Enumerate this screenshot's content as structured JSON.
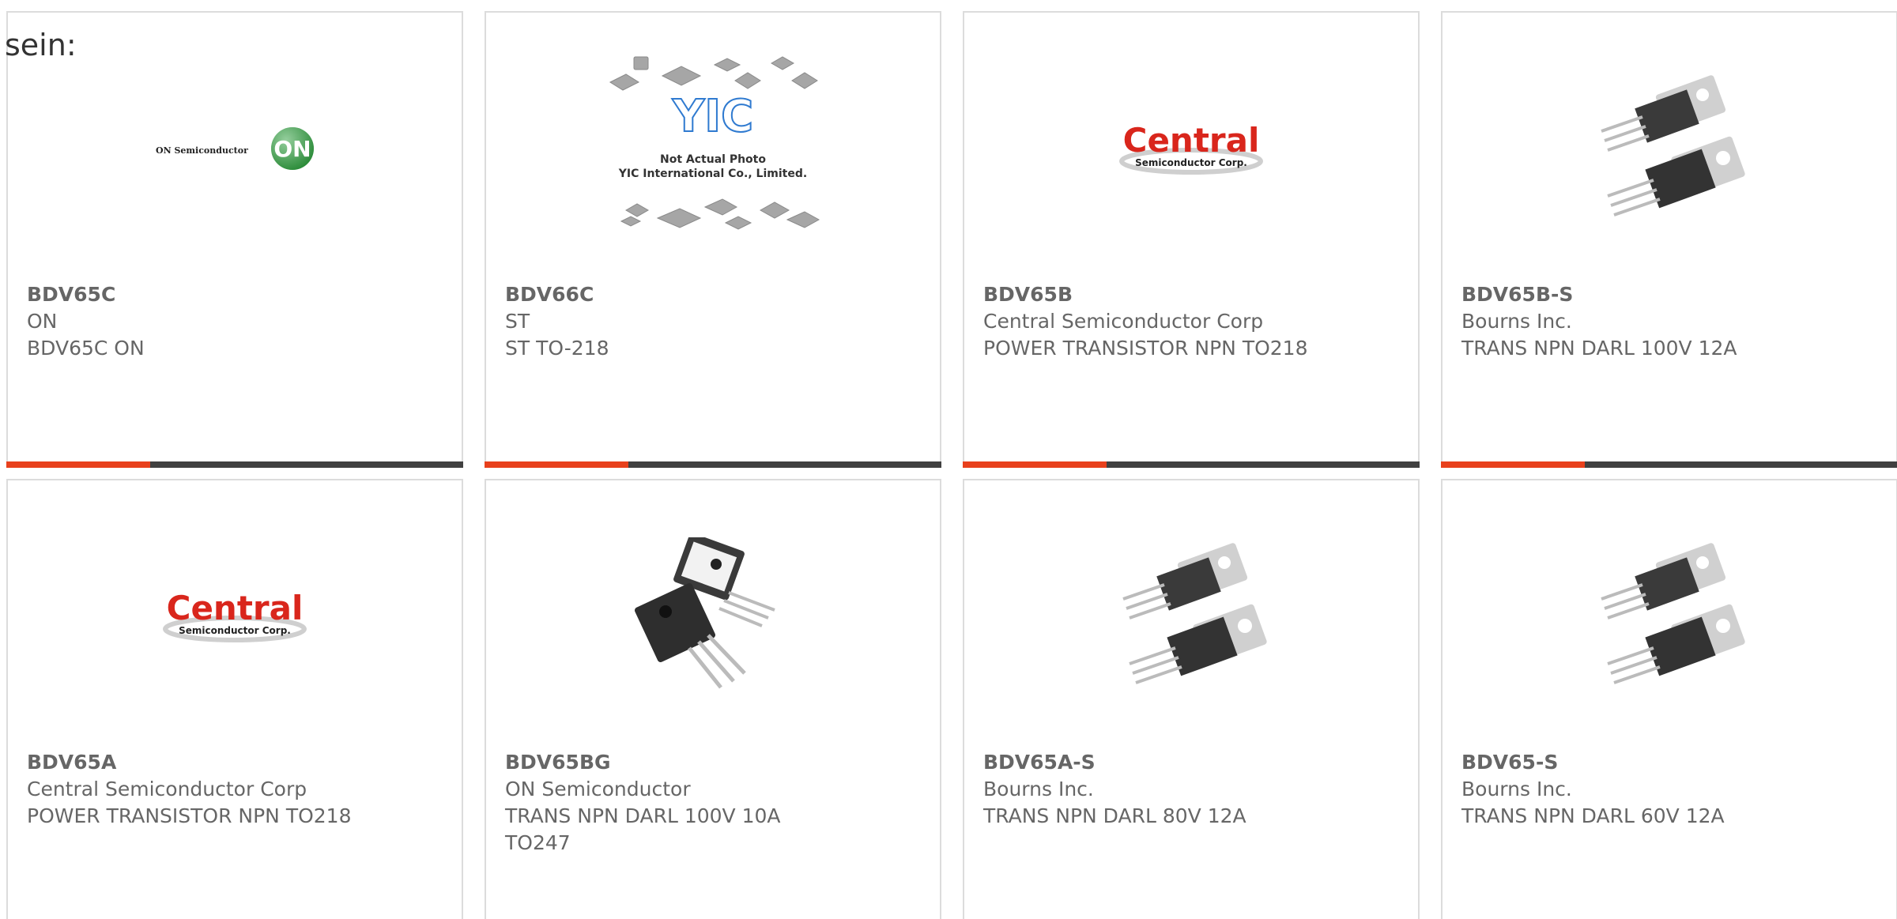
{
  "intro_text": "sein:",
  "products": [
    {
      "part": "BDV65C",
      "manufacturer": "ON",
      "description": "BDV65C ON",
      "image": "on-semiconductor-logo",
      "image_text": [
        "ON Semiconductor",
        "ON"
      ]
    },
    {
      "part": "BDV66C",
      "manufacturer": "ST",
      "description": "ST TO-218",
      "image": "yic-not-actual-photo",
      "image_text": [
        "YIC",
        "Not Actual Photo",
        "YIC International Co., Limited."
      ]
    },
    {
      "part": "BDV65B",
      "manufacturer": "Central Semiconductor Corp",
      "description": "POWER TRANSISTOR NPN TO218",
      "image": "central-semiconductor-logo",
      "image_text": [
        "Central",
        "Semiconductor Corp."
      ]
    },
    {
      "part": "BDV65B-S",
      "manufacturer": "Bourns Inc.",
      "description": "TRANS NPN DARL 100V 12A",
      "image": "to220-transistor-photo"
    },
    {
      "part": "BDV65A",
      "manufacturer": "Central Semiconductor Corp",
      "description": "POWER TRANSISTOR NPN TO218",
      "image": "central-semiconductor-logo",
      "image_text": [
        "Central",
        "Semiconductor Corp."
      ]
    },
    {
      "part": "BDV65BG",
      "manufacturer": "ON Semiconductor",
      "description": "TRANS NPN DARL 100V 10A TO247",
      "image": "to247-transistor-photo"
    },
    {
      "part": "BDV65A-S",
      "manufacturer": "Bourns Inc.",
      "description": "TRANS NPN DARL 80V 12A",
      "image": "to220-transistor-photo"
    },
    {
      "part": "BDV65-S",
      "manufacturer": "Bourns Inc.",
      "description": "TRANS NPN DARL 60V 12A",
      "image": "to220-transistor-photo"
    }
  ],
  "colors": {
    "accent": "#e8401c",
    "bar": "#404040",
    "text": "#666666",
    "border": "#dcdcdc",
    "on_logo_green": "#2a9d3a",
    "central_red": "#d9261c"
  }
}
